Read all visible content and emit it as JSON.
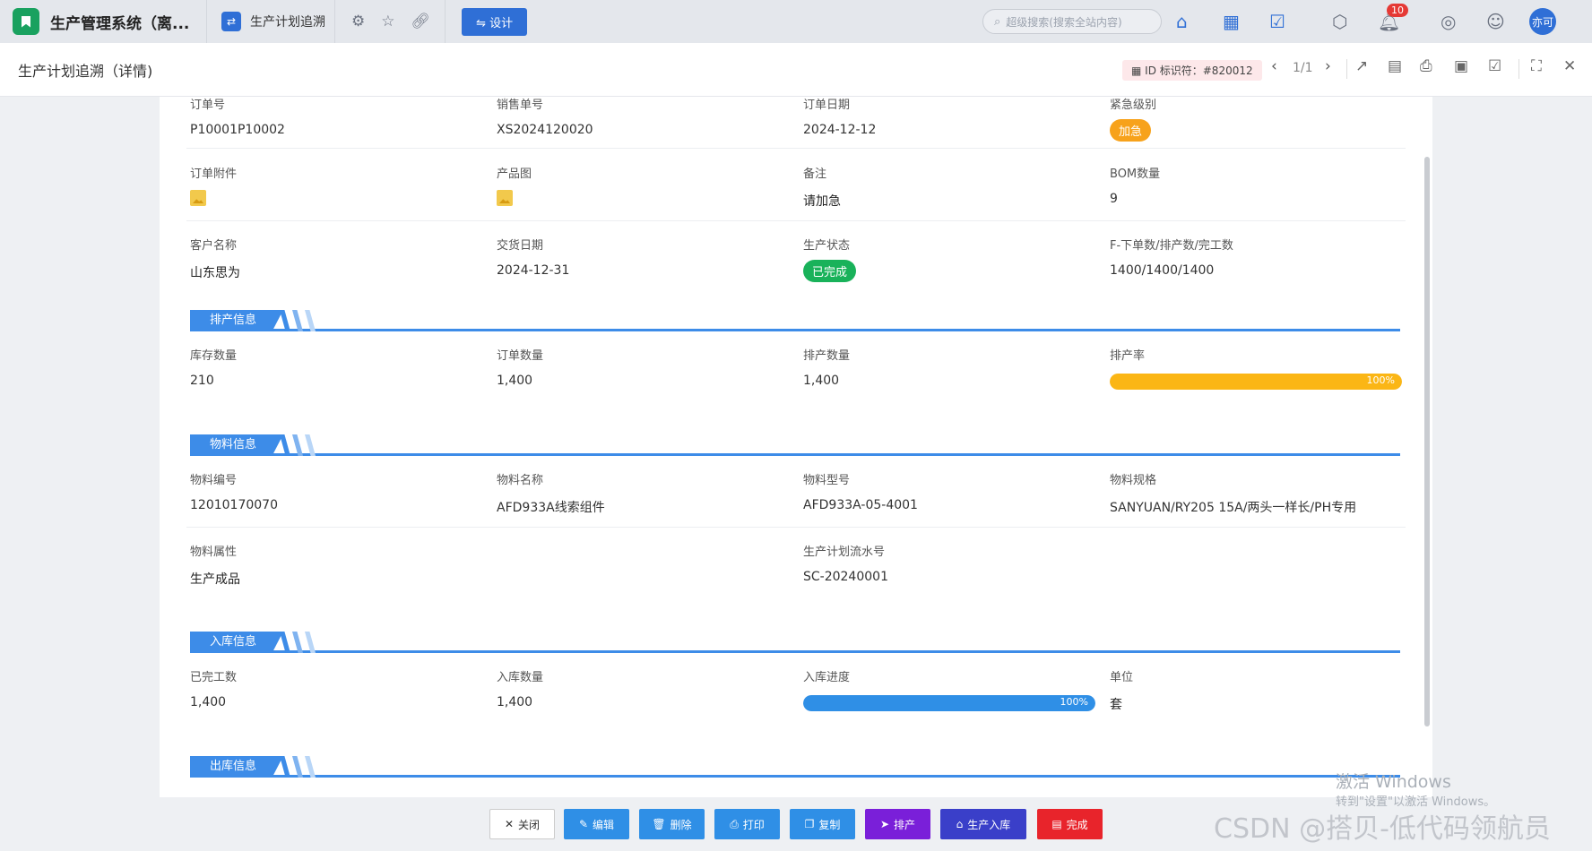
{
  "app": {
    "title": "生产管理系统（离...",
    "tab_title": "生产计划追溯",
    "design_label": "设计"
  },
  "search": {
    "placeholder": "超级搜索(搜索全站内容)"
  },
  "notifications": {
    "count": "10"
  },
  "user": {
    "avatar_text": "亦可"
  },
  "header": {
    "title": "生产计划追溯（详情)",
    "id_chip": "ID 标识符：#820012",
    "pager": "1/1"
  },
  "rows": {
    "r1": [
      {
        "label": "订单号",
        "value": "P10001P10002"
      },
      {
        "label": "销售单号",
        "value": "XS2024120020"
      },
      {
        "label": "订单日期",
        "value": "2024-12-12"
      },
      {
        "label": "紧急级别",
        "value": "加急"
      }
    ],
    "r2": [
      {
        "label": "订单附件"
      },
      {
        "label": "产品图"
      },
      {
        "label": "备注",
        "value": "请加急"
      },
      {
        "label": "BOM数量",
        "value": "9"
      }
    ],
    "r3": [
      {
        "label": "客户名称",
        "value": "山东思为"
      },
      {
        "label": "交货日期",
        "value": "2024-12-31"
      },
      {
        "label": "生产状态",
        "value": "已完成"
      },
      {
        "label": "F-下单数/排产数/完工数",
        "value": "1400/1400/1400"
      }
    ]
  },
  "sections": {
    "schedule": {
      "title": "排产信息",
      "fields": [
        {
          "label": "库存数量",
          "value": "210"
        },
        {
          "label": "订单数量",
          "value": "1,400"
        },
        {
          "label": "排产数量",
          "value": "1,400"
        },
        {
          "label": "排产率",
          "value": "100%",
          "progress": 1.0
        }
      ]
    },
    "material": {
      "title": "物料信息",
      "fields": [
        {
          "label": "物料编号",
          "value": "12010170070"
        },
        {
          "label": "物料名称",
          "value": "AFD933A线索组件"
        },
        {
          "label": "物料型号",
          "value": "AFD933A-05-4001"
        },
        {
          "label": "物料规格",
          "value": "SANYUAN/RY205 15A/两头一样长/PH专用"
        },
        {
          "label": "物料属性",
          "value": "生产成品"
        },
        {
          "label": "生产计划流水号",
          "value": "SC-20240001"
        }
      ]
    },
    "storage": {
      "title": "入库信息",
      "fields": [
        {
          "label": "已完工数",
          "value": "1,400"
        },
        {
          "label": "入库数量",
          "value": "1,400"
        },
        {
          "label": "入库进度",
          "value": "100%",
          "progress": 1.0
        },
        {
          "label": "单位",
          "value": "套"
        }
      ]
    },
    "outbound": {
      "title": "出库信息"
    }
  },
  "footer": {
    "close": "关闭",
    "edit": "编辑",
    "delete": "删除",
    "print": "打印",
    "copy": "复制",
    "schedule": "排产",
    "warehouse": "生产入库",
    "complete": "完成"
  },
  "overlay": {
    "windows_activate": "激活 Windows",
    "windows_hint": "转到\"设置\"以激活 Windows。",
    "csdn": "CSDN @搭贝-低代码领航员"
  },
  "colors": {
    "accent": "#3d8ce8",
    "orange": "#f7a21b",
    "green": "#19b25a",
    "progress_yellow": "#fbb615",
    "progress_blue": "#2f8fe6"
  }
}
